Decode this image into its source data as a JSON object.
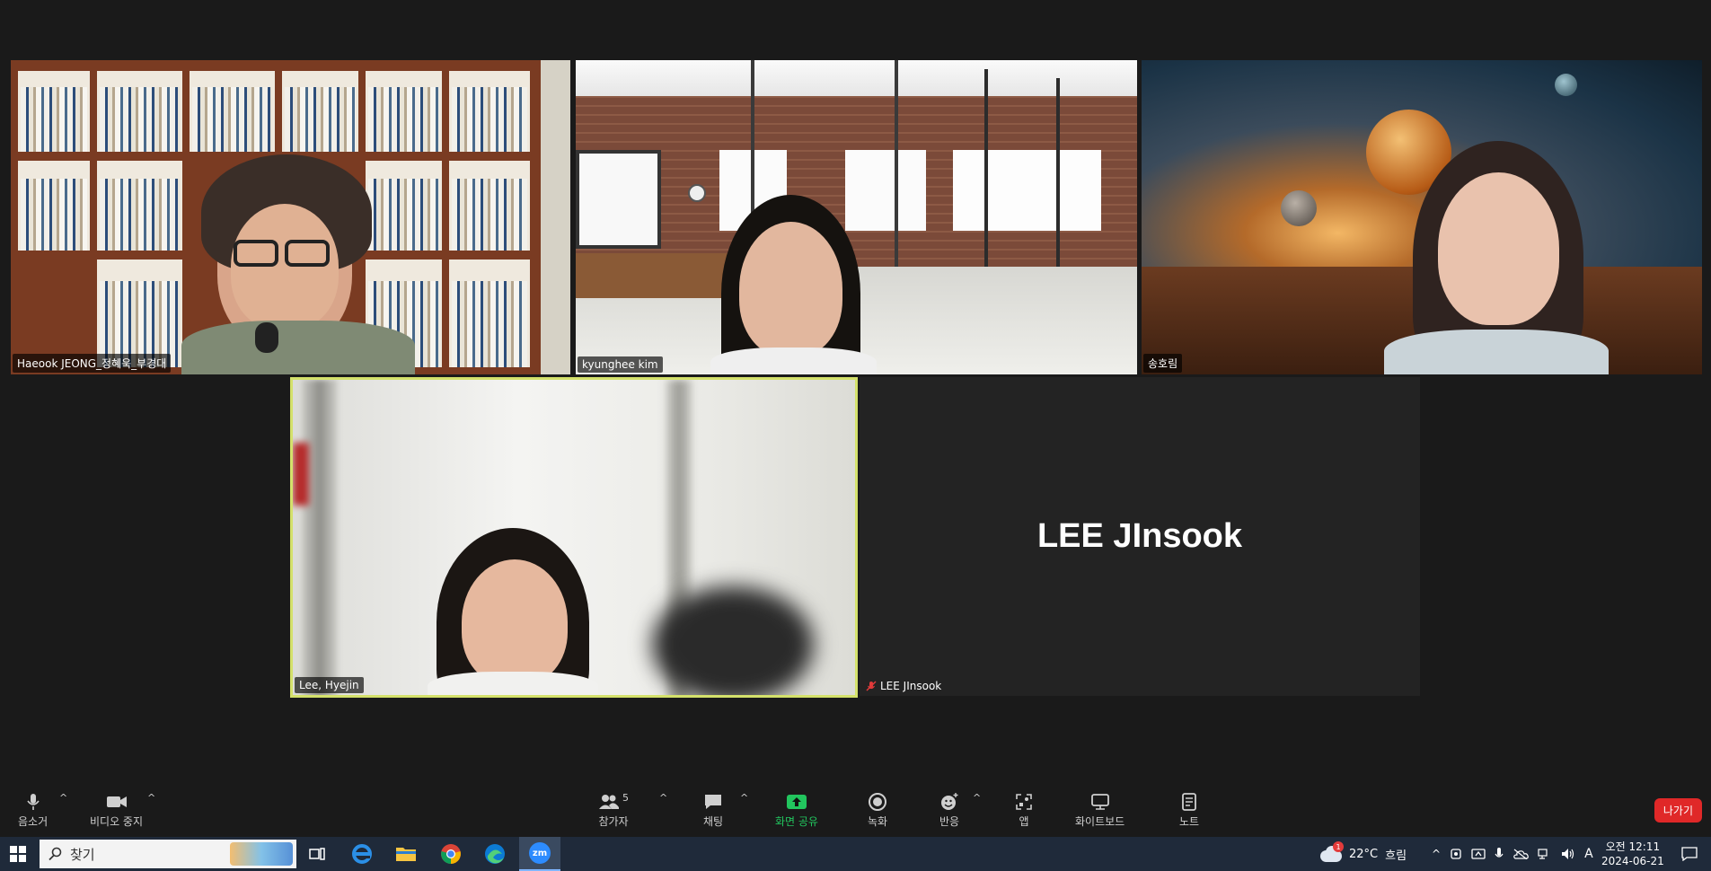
{
  "participants": [
    {
      "name": "Haeook JEONG_정혜욱_부경대"
    },
    {
      "name": "kyunghee kim"
    },
    {
      "name": "송호림"
    },
    {
      "name": "Lee, Hyejin"
    },
    {
      "name": "LEE JInsook",
      "big_label": "LEE JInsook",
      "muted": true
    }
  ],
  "toolbar": {
    "mute": "음소거",
    "video": "비디오 중지",
    "participants": "참가자",
    "participants_count": "5",
    "chat": "채팅",
    "share": "화면 공유",
    "record": "녹화",
    "reactions": "반응",
    "apps": "앱",
    "whiteboard": "화이트보드",
    "notes": "노트",
    "leave": "나가기"
  },
  "taskbar": {
    "search_placeholder": "찾기",
    "weather_temp": "22°C",
    "weather_text": "흐림",
    "weather_badge": "1",
    "ime": "A",
    "time": "오전 12:11",
    "date": "2024-06-21",
    "zoom_label": "zm"
  },
  "colors": {
    "active_speaker_border": "#d4e16b",
    "share_green": "#22c55e",
    "leave_red": "#e02828"
  }
}
